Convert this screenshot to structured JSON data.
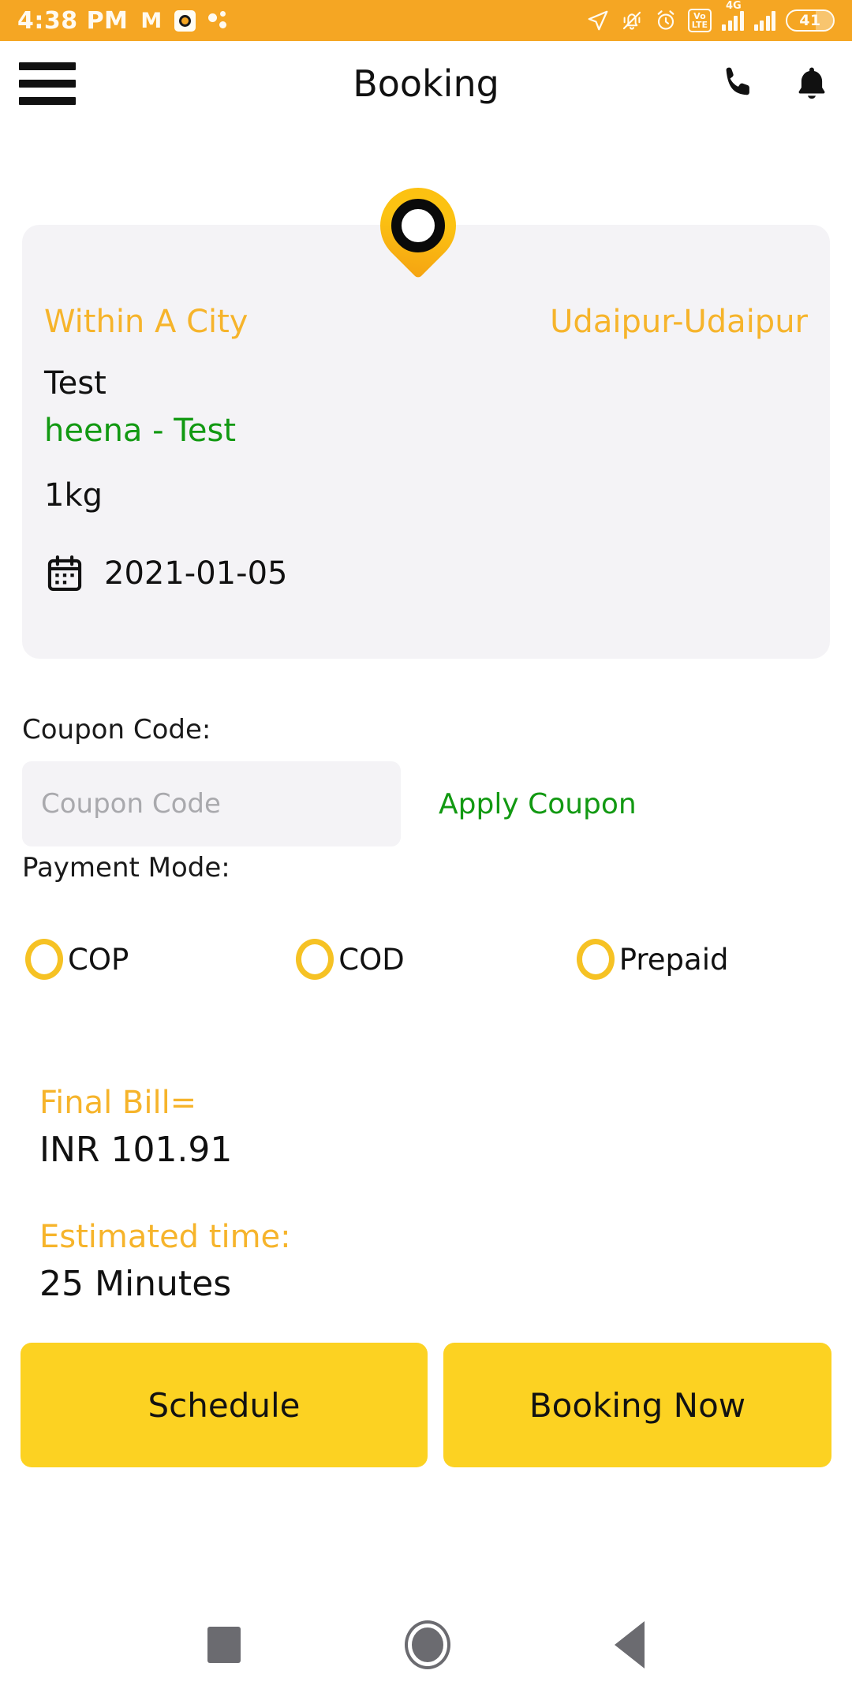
{
  "statusbar": {
    "time": "4:38 PM",
    "gmail_glyph": "M",
    "battery_level": "41",
    "network": "4G",
    "volte_top": "Vo",
    "volte_bottom": "LTE",
    "icons": [
      "gmail-icon",
      "app-icon",
      "dots-icon",
      "location-arrow-icon",
      "bell-muted-icon",
      "alarm-icon",
      "volte-icon",
      "signal-4g-icon",
      "signal-icon",
      "battery-icon"
    ],
    "bar_color": "#f5a623"
  },
  "appbar": {
    "title": "Booking",
    "menu_icon": "hamburger-icon",
    "call_icon": "phone-icon",
    "notification_icon": "bell-icon"
  },
  "booking_card": {
    "service_type": "Within A City",
    "route": "Udaipur-Udaipur",
    "receiver": "Test",
    "sender_line": "heena - Test",
    "weight": "1kg",
    "date": "2021-01-05",
    "date_icon": "calendar-icon",
    "pin_icon": "map-pin-icon"
  },
  "coupon": {
    "label": "Coupon Code:",
    "value": "",
    "placeholder": "Coupon Code",
    "apply_label": "Apply Coupon"
  },
  "payment": {
    "label": "Payment Mode:",
    "options": [
      {
        "label": "COP",
        "selected": false
      },
      {
        "label": "COD",
        "selected": false
      },
      {
        "label": "Prepaid",
        "selected": false
      }
    ]
  },
  "totals": {
    "bill_label": "Final Bill=",
    "bill_value": "INR 101.91",
    "eta_label": "Estimated time:",
    "eta_value": "25 Minutes"
  },
  "actions": {
    "schedule_label": "Schedule",
    "book_now_label": "Booking Now"
  },
  "navbar": {
    "recents_icon": "square-recents-icon",
    "home_icon": "circle-home-icon",
    "back_icon": "triangle-back-icon"
  },
  "colors": {
    "accent_orange": "#f5a623",
    "brand_yellow": "#fcd222",
    "label_orange": "#f6b42b",
    "green": "#129912",
    "card_bg": "#f4f3f6"
  }
}
